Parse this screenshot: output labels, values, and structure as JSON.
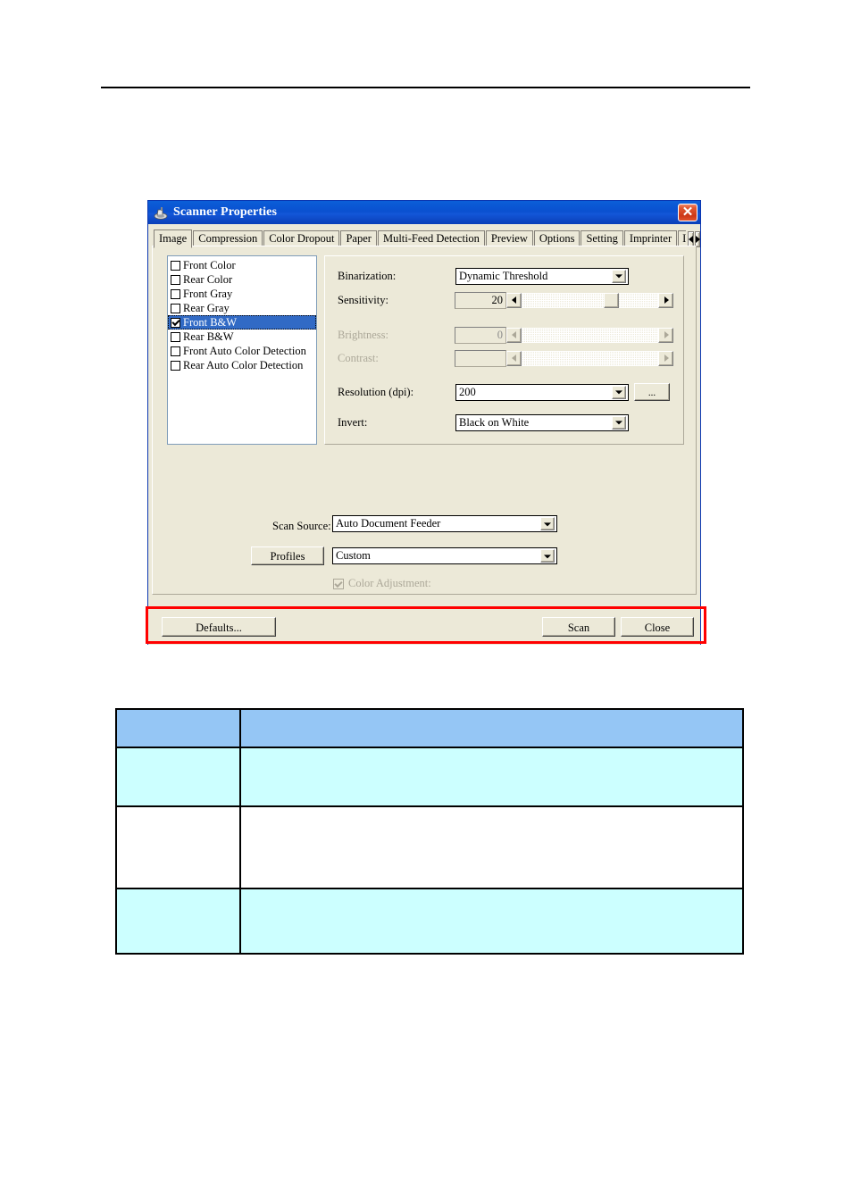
{
  "page": {
    "rule": "horizontal-rule"
  },
  "dialog": {
    "title": "Scanner Properties",
    "title_icon": "scanner-icon",
    "close_label": "✕",
    "tabs": [
      {
        "label": "Image",
        "active": true
      },
      {
        "label": "Compression",
        "active": false
      },
      {
        "label": "Color Dropout",
        "active": false
      },
      {
        "label": "Paper",
        "active": false
      },
      {
        "label": "Multi-Feed Detection",
        "active": false
      },
      {
        "label": "Preview",
        "active": false
      },
      {
        "label": "Options",
        "active": false
      },
      {
        "label": "Setting",
        "active": false
      },
      {
        "label": "Imprinter",
        "active": false
      },
      {
        "label": "In",
        "active": false,
        "clipped": true
      }
    ],
    "tab_scroll_left": "scroll-left-arrow",
    "tab_scroll_right": "scroll-right-arrow",
    "image_types": [
      {
        "label": "Front Color",
        "checked": false,
        "selected": false
      },
      {
        "label": "Rear Color",
        "checked": false,
        "selected": false
      },
      {
        "label": "Front Gray",
        "checked": false,
        "selected": false
      },
      {
        "label": "Rear Gray",
        "checked": false,
        "selected": false
      },
      {
        "label": "Front B&W",
        "checked": true,
        "selected": true
      },
      {
        "label": "Rear B&W",
        "checked": false,
        "selected": false
      },
      {
        "label": "Front Auto Color Detection",
        "checked": false,
        "selected": false
      },
      {
        "label": "Rear Auto Color Detection",
        "checked": false,
        "selected": false
      }
    ],
    "settings": {
      "binarization_label": "Binarization:",
      "binarization_value": "Dynamic Threshold",
      "sensitivity_label": "Sensitivity:",
      "sensitivity_value": "20",
      "sensitivity_percent": 60,
      "brightness_label": "Brightness:",
      "brightness_value": "0",
      "contrast_label": "Contrast:",
      "contrast_value": "",
      "resolution_label": "Resolution (dpi):",
      "resolution_value": "200",
      "resolution_more_label": "...",
      "invert_label": "Invert:",
      "invert_value": "Black on White"
    },
    "lower": {
      "scan_source_label": "Scan Source:",
      "scan_source_value": "Auto Document Feeder",
      "profiles_button": "Profiles",
      "profiles_value": "Custom",
      "color_adjustment_label": "Color Adjustment:",
      "color_adjustment_checked": true
    },
    "buttons": {
      "defaults": "Defaults...",
      "scan": "Scan",
      "close": "Close"
    },
    "highlight_color": "#ff0000"
  },
  "table": {
    "header_color": "#95c6f5",
    "row_alt_color": "#ccffff",
    "rows": [
      {
        "style": "header",
        "col1": "",
        "col2": ""
      },
      {
        "style": "alt",
        "col1": "",
        "col2": ""
      },
      {
        "style": "plain",
        "col1": "",
        "col2": ""
      },
      {
        "style": "alt",
        "col1": "",
        "col2": ""
      }
    ]
  }
}
